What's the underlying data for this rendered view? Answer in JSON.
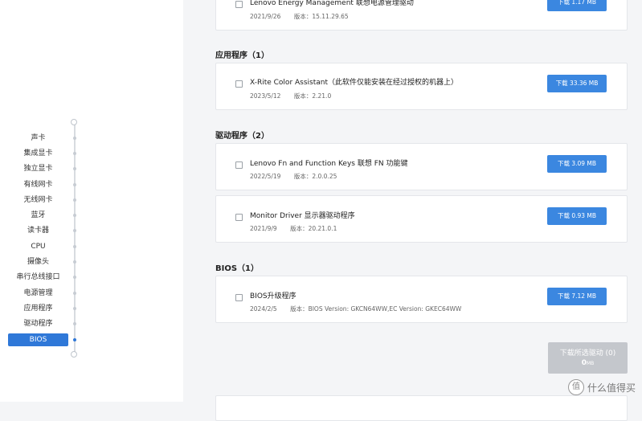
{
  "sidebar": {
    "items": [
      {
        "label": "声卡",
        "active": false
      },
      {
        "label": "集成显卡",
        "active": false
      },
      {
        "label": "独立显卡",
        "active": false
      },
      {
        "label": "有线网卡",
        "active": false
      },
      {
        "label": "无线网卡",
        "active": false
      },
      {
        "label": "蓝牙",
        "active": false
      },
      {
        "label": "读卡器",
        "active": false
      },
      {
        "label": "CPU",
        "active": false
      },
      {
        "label": "摄像头",
        "active": false
      },
      {
        "label": "串行总线接口",
        "active": false
      },
      {
        "label": "电源管理",
        "active": false
      },
      {
        "label": "应用程序",
        "active": false
      },
      {
        "label": "驱动程序",
        "active": false
      },
      {
        "label": "BIOS",
        "active": true
      }
    ]
  },
  "top_card": {
    "title": "Lenovo Energy Management 联想电源管理驱动",
    "date": "2021/9/26",
    "version": "版本：15.11.29.65",
    "button": "下载 1.17 MB"
  },
  "sections": {
    "apps": {
      "title": "应用程序（1）",
      "items": [
        {
          "title": "X-Rite Color Assistant（此软件仅能安装在经过授权的机器上）",
          "date": "2023/5/12",
          "version": "版本：2.21.0",
          "button": "下载 33.36 MB"
        }
      ]
    },
    "drivers": {
      "title": "驱动程序（2）",
      "items": [
        {
          "title": "Lenovo Fn and Function Keys 联想 FN 功能键",
          "date": "2022/5/19",
          "version": "版本：2.0.0.25",
          "button": "下载 3.09 MB"
        },
        {
          "title": "Monitor Driver 显示器驱动程序",
          "date": "2021/9/9",
          "version": "版本：20.21.0.1",
          "button": "下载 0.93 MB"
        }
      ]
    },
    "bios": {
      "title": "BIOS（1）",
      "items": [
        {
          "title": "BIOS升级程序",
          "date": "2024/2/5",
          "version": "版本：BIOS Version: GKCN64WW,EC Version: GKEC64WW",
          "button": "下载 7.12 MB"
        }
      ]
    }
  },
  "download_selected": {
    "label": "下载所选驱动 (0)",
    "size_value": "0",
    "size_unit": "MB"
  },
  "watermark": {
    "icon": "值",
    "text": "什么值得买"
  },
  "colors": {
    "accent": "#3b87e0",
    "active_nav": "#2f78d8",
    "disabled": "#c4c7cc"
  }
}
